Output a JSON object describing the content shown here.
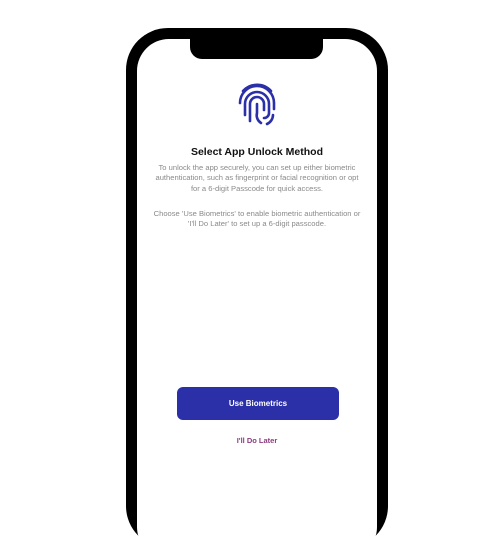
{
  "screen": {
    "title": "Select App Unlock Method",
    "paragraph1": "To unlock the app securely, you can set up either biometric authentication, such as fingerprint or facial recognition or opt for a 6-digit Passcode for quick access.",
    "paragraph2": "Choose 'Use Biometrics' to enable biometric authentication or 'I'll Do Later' to set up a 6-digit passcode.",
    "primary_button": "Use Biometrics",
    "secondary_link": "I'll Do Later",
    "icon": "fingerprint-icon"
  },
  "colors": {
    "accent": "#2b2fa8",
    "link": "#8b3a7e"
  }
}
